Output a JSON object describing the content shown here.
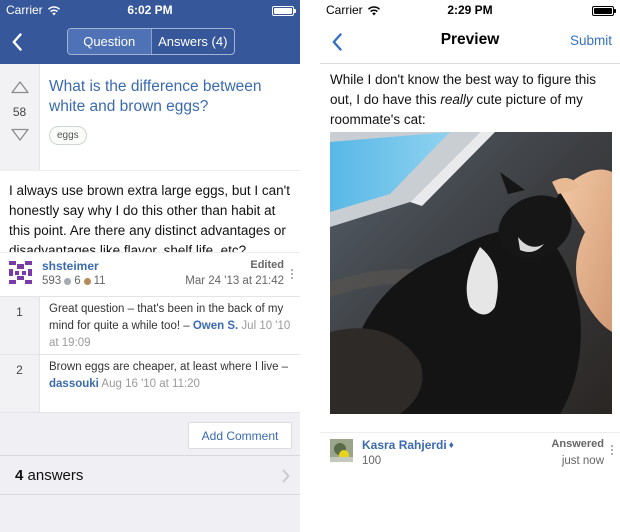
{
  "colors": {
    "nav_blue": "#37579b",
    "link_blue": "#3a6ab0",
    "ios_blue": "#3570c3",
    "identicon": "#7a3aa8"
  },
  "left": {
    "status": {
      "carrier": "Carrier",
      "time": "6:02 PM"
    },
    "nav": {
      "back_icon": "chevron-left-icon",
      "tabs": [
        {
          "label": "Question",
          "active": true
        },
        {
          "label": "Answers (4)",
          "active": false
        }
      ]
    },
    "question": {
      "score": "58",
      "title": "What is the difference between white and brown eggs?",
      "tag": "eggs",
      "body": "I always use brown extra large eggs, but I can't honestly say why I do this other than habit at this point. Are there any distinct advantages or disadvantages like flavor, shelf life, etc?",
      "owner": {
        "name": "shsteimer",
        "reputation": "593",
        "silver": "6",
        "bronze": "11",
        "edited_label": "Edited",
        "date": "Mar 24 '13 at 21:42"
      }
    },
    "comments": [
      {
        "score": "1",
        "text": "Great question – that's been in the back of my mind for quite a while too! –",
        "author": "Owen S.",
        "date": "Jul 10 '10 at 19:09"
      },
      {
        "score": "2",
        "text": "Brown eggs are cheaper, at least where I live –",
        "author": "dassouki",
        "date": "Aug 16 '10 at 11:20"
      }
    ],
    "add_comment": "Add Comment",
    "answers_count": "4",
    "answers_word": "answers"
  },
  "right": {
    "status": {
      "carrier": "Carrier",
      "time": "2:29 PM"
    },
    "nav": {
      "title": "Preview",
      "submit": "Submit",
      "back_icon": "chevron-left-icon"
    },
    "body_before": "While I don't know the best way to figure this out, I do have this ",
    "body_emphasis": "really",
    "body_after": " cute picture of my roommate's cat:",
    "owner": {
      "name": "Kasra Rahjerdi",
      "moderator": "♦",
      "reputation": "100",
      "answered_label": "Answered",
      "time": "just now"
    }
  }
}
